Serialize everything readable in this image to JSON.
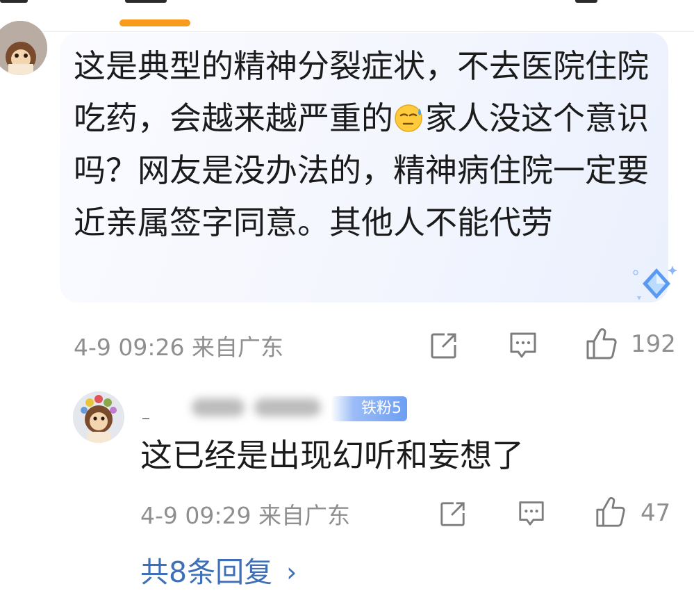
{
  "main_comment": {
    "text_before_emoji": "这是典型的精神分裂症状，不去医院住院吃药，会越来越严重的",
    "emoji": "sweat-emoji",
    "text_after_emoji": "家人没这个意识吗？网友是没办法的，精神病住院一定要近亲属签字同意。其他人不能代劳",
    "time_location": "4-9 09:26 来自广东",
    "like_count": "192"
  },
  "reply": {
    "fan_badge": "铁粉5",
    "text": "这已经是出现幻听和妄想了",
    "time_location": "4-9 09:29 来自广东",
    "like_count": "47"
  },
  "more_replies": {
    "label": "共8条回复",
    "chevron": "›"
  },
  "colors": {
    "accent_tab_indicator": "#f89a1c",
    "link_blue": "#3f6fb8",
    "badge_blue": "#6d9ef3"
  },
  "icons": [
    "share-icon",
    "comment-icon",
    "like-icon",
    "diamond-badge-icon"
  ]
}
